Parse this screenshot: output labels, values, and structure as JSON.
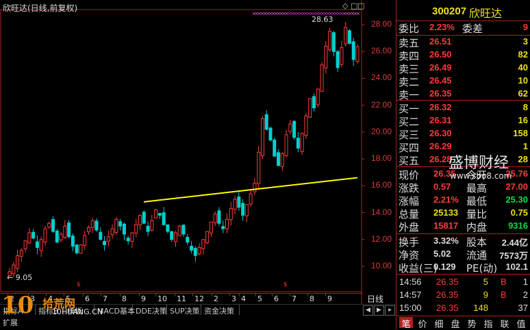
{
  "chart": {
    "title": "欣旺达(日线,前复权)",
    "controls": [
      "◇",
      "□",
      "□"
    ],
    "price_axis": [
      "28.00",
      "26.00",
      "24.00",
      "22.00",
      "20.00",
      "18.00",
      "16.00",
      "14.00",
      "12.00",
      "10.00"
    ],
    "high_label": "28.63",
    "low_label": "← 9.05",
    "months": [
      "2",
      "3",
      "4",
      "5",
      "6",
      "7",
      "8",
      "9",
      "10",
      "11",
      "12",
      "2",
      "3",
      "4",
      "5",
      "6",
      "7",
      "8",
      "9"
    ],
    "period": "日线",
    "tabs": [
      "指标A",
      "指标B",
      "模板",
      "MACD基本",
      "DDE决策",
      "SUP决策",
      "资金决策"
    ],
    "bottom_text": "扩展",
    "watermark": {
      "logo": "10",
      "name": "拾荒网",
      "url": "10HUANG.CN"
    },
    "colors": {
      "up": "#ff3c3c",
      "down": "#00d0d0",
      "trendline": "#ffff00",
      "grid": "#b02020"
    }
  },
  "chart_data": {
    "type": "candlestick",
    "ylim": [
      9,
      28.63
    ],
    "low": 9.05,
    "high": 28.63,
    "trendline": {
      "from": 14.8,
      "to": 16.6
    },
    "closes": [
      9.6,
      10.1,
      10.8,
      11.2,
      11.9,
      12.5,
      12.1,
      11.4,
      12.0,
      12.8,
      13.2,
      12.6,
      11.8,
      12.4,
      13.0,
      12.2,
      11.5,
      11.0,
      11.6,
      12.3,
      12.9,
      13.4,
      12.7,
      12.0,
      11.6,
      12.2,
      12.8,
      13.5,
      13.0,
      12.4,
      11.9,
      12.5,
      13.1,
      13.8,
      13.2,
      12.6,
      13.4,
      14.2,
      13.8,
      13.1,
      12.6,
      12.0,
      12.5,
      13.0,
      12.4,
      11.8,
      11.2,
      10.8,
      11.4,
      12.0,
      12.6,
      13.3,
      13.9,
      13.2,
      12.8,
      13.5,
      14.3,
      15.0,
      14.4,
      13.8,
      14.6,
      15.4,
      16.2,
      18.5,
      21.0,
      20.2,
      19.4,
      18.2,
      17.5,
      18.4,
      19.8,
      20.6,
      19.6,
      18.8,
      19.9,
      21.2,
      22.5,
      21.8,
      23.2,
      25.0,
      26.4,
      27.5,
      26.0,
      24.8,
      26.3,
      27.8,
      26.6,
      25.4,
      26.35
    ],
    "quote_values_in_chart": false
  },
  "quote": {
    "code": "300207",
    "name": "欣旺达",
    "weibi": {
      "label": "委比",
      "value": "2.23%",
      "label2": "委差",
      "value2": "9"
    },
    "asks": [
      {
        "label": "卖五",
        "price": "26.51",
        "vol": "3"
      },
      {
        "label": "卖四",
        "price": "26.50",
        "vol": "82"
      },
      {
        "label": "卖三",
        "price": "26.49",
        "vol": "40"
      },
      {
        "label": "卖二",
        "price": "26.45",
        "vol": "10"
      },
      {
        "label": "卖一",
        "price": "26.35",
        "vol": "62"
      }
    ],
    "bids": [
      {
        "label": "买一",
        "price": "26.32",
        "vol": "8"
      },
      {
        "label": "买二",
        "price": "26.31",
        "vol": "16"
      },
      {
        "label": "买三",
        "price": "26.30",
        "vol": "158"
      },
      {
        "label": "买四",
        "price": "26.29",
        "vol": "1"
      },
      {
        "label": "买五",
        "price": "26.28",
        "vol": "28"
      }
    ],
    "stats": [
      {
        "l1": "现价",
        "v1": "26.35",
        "l2": "今开",
        "v2": "25.76"
      },
      {
        "l1": "涨跌",
        "v1": "0.57",
        "l2": "最高",
        "v2": "27.00"
      },
      {
        "l1": "涨幅",
        "v1": "2.21%",
        "l2": "最低",
        "v2": "25.30"
      },
      {
        "l1": "总量",
        "v1": "25133",
        "l2": "量比",
        "v2": "0.75"
      },
      {
        "l1": "外盘",
        "v1": "15817",
        "l2": "内盘",
        "v2": "9316"
      }
    ],
    "fund": [
      {
        "l1": "换手",
        "v1": "3.32%",
        "l2": "股本",
        "v2": "2.44亿"
      },
      {
        "l1": "净资",
        "v1": "5.02",
        "l2": "流通",
        "v2": "7573万"
      },
      {
        "l1": "收益(三)",
        "v1": "0.129",
        "l2": "PE(动)",
        "v2": "102.1"
      }
    ],
    "trades": [
      {
        "time": "14:56",
        "price": "26.35",
        "vol": "5",
        "side": "B",
        "num": "1"
      },
      {
        "time": "14:57",
        "price": "26.35",
        "vol": "9",
        "side": "B",
        "num": "2"
      },
      {
        "time": "15:00",
        "price": "26.35",
        "vol": "148",
        "side": "",
        "num": "37"
      }
    ],
    "tabs": [
      "笔",
      "价",
      "细",
      "盘",
      "势",
      "指",
      "联",
      "值"
    ],
    "watermark": {
      "name": "盛博财经",
      "url": "www.sbo8.com"
    }
  }
}
